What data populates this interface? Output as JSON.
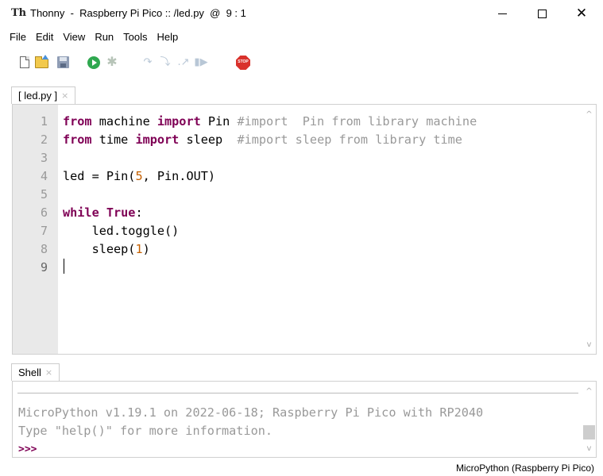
{
  "window": {
    "app_icon_text": "Th",
    "title": "Thonny  -  Raspberry Pi Pico :: /led.py  @  9 : 1"
  },
  "menu": [
    "File",
    "Edit",
    "View",
    "Run",
    "Tools",
    "Help"
  ],
  "toolbar": {
    "icons": [
      "new-file-icon",
      "open-file-icon",
      "save-icon",
      "run-icon",
      "debug-icon",
      "step-over-icon",
      "step-into-icon",
      "step-out-icon",
      "resume-icon",
      "stop-icon"
    ],
    "stop_label": "STOP"
  },
  "editor": {
    "tab_label": "[ led.py ]",
    "tab_close": "×",
    "lines": [
      {
        "no": "1",
        "tokens": [
          {
            "t": "from",
            "c": "kw"
          },
          {
            "t": " machine ",
            "c": ""
          },
          {
            "t": "import",
            "c": "kw"
          },
          {
            "t": " Pin ",
            "c": ""
          },
          {
            "t": "#import  Pin from library machine",
            "c": "cm"
          }
        ]
      },
      {
        "no": "2",
        "tokens": [
          {
            "t": "from",
            "c": "kw"
          },
          {
            "t": " time ",
            "c": ""
          },
          {
            "t": "import",
            "c": "kw"
          },
          {
            "t": " sleep  ",
            "c": ""
          },
          {
            "t": "#import sleep from library time",
            "c": "cm"
          }
        ]
      },
      {
        "no": "3",
        "tokens": []
      },
      {
        "no": "4",
        "tokens": [
          {
            "t": "led = Pin(",
            "c": ""
          },
          {
            "t": "5",
            "c": "num"
          },
          {
            "t": ", Pin.OUT)",
            "c": ""
          }
        ]
      },
      {
        "no": "5",
        "tokens": []
      },
      {
        "no": "6",
        "tokens": [
          {
            "t": "while",
            "c": "kw"
          },
          {
            "t": " ",
            "c": ""
          },
          {
            "t": "True",
            "c": "kw"
          },
          {
            "t": ":",
            "c": ""
          }
        ]
      },
      {
        "no": "7",
        "tokens": [
          {
            "t": "    led.toggle()",
            "c": ""
          }
        ]
      },
      {
        "no": "8",
        "tokens": [
          {
            "t": "    sleep(",
            "c": ""
          },
          {
            "t": "1",
            "c": "num"
          },
          {
            "t": ")",
            "c": ""
          }
        ]
      },
      {
        "no": "9",
        "tokens": []
      }
    ]
  },
  "shell": {
    "tab_label": "Shell",
    "tab_close": "×",
    "lines": [
      "MicroPython v1.19.1 on 2022-06-18; Raspberry Pi Pico with RP2040",
      "Type \"help()\" for more information."
    ],
    "prompt": ">>>"
  },
  "status": {
    "interpreter": "MicroPython (Raspberry Pi Pico)"
  }
}
